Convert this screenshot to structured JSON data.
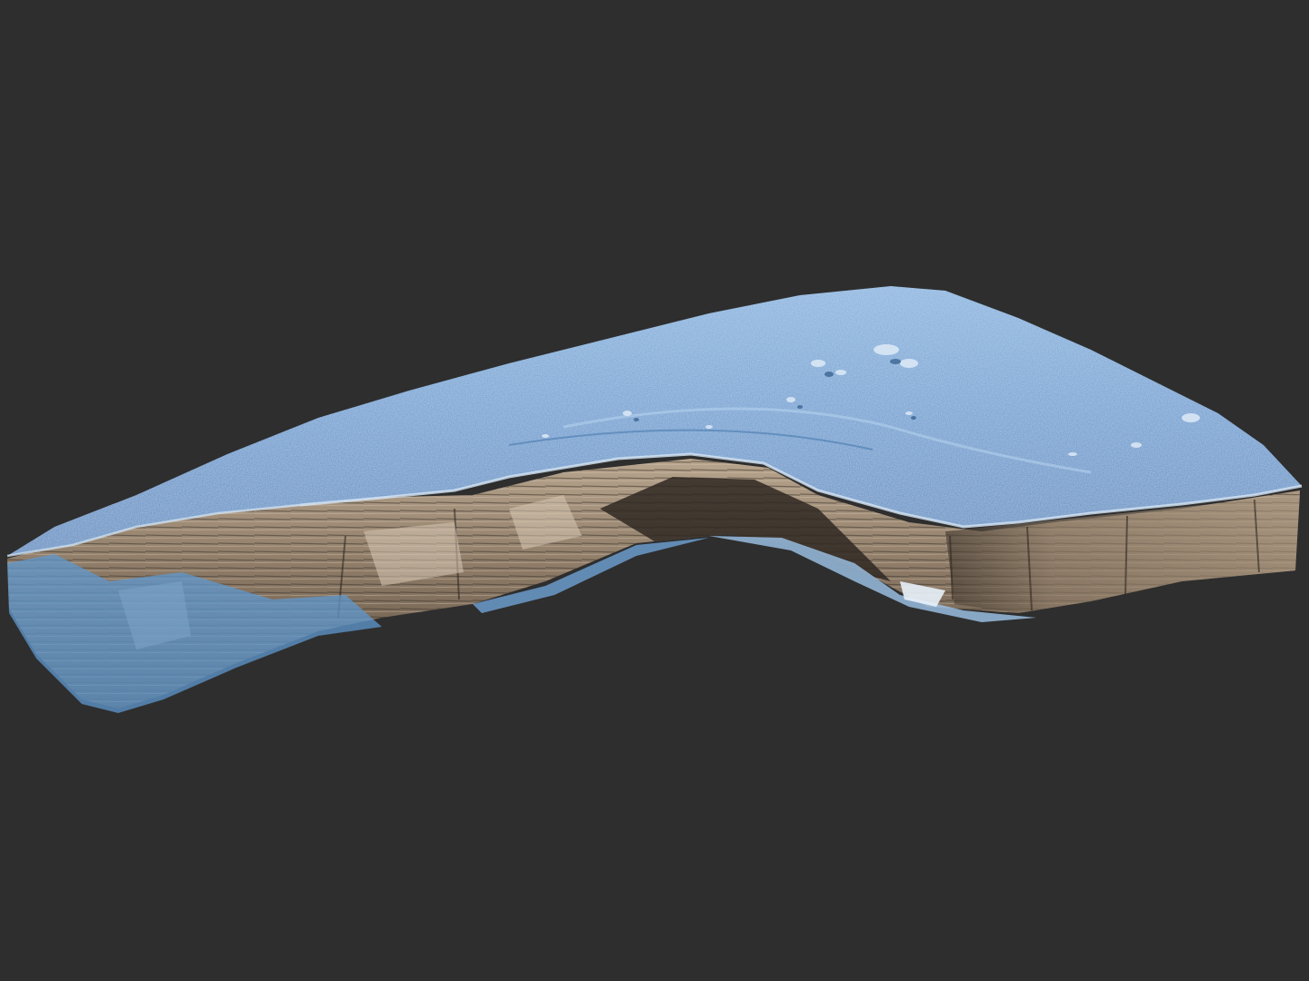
{
  "viewport": {
    "background_color": "#2e2e2e"
  },
  "model": {
    "kind": "3d-terrain-mesh",
    "colors": {
      "top_surface_light": "#9fc6ea",
      "top_surface_mid": "#5f98cf",
      "top_surface_dark": "#3a6fa6",
      "cliff_light": "#c9b8a2",
      "cliff_mid": "#8c7a66",
      "cliff_dark": "#3f362d",
      "highlight": "#e8f2fb"
    }
  }
}
